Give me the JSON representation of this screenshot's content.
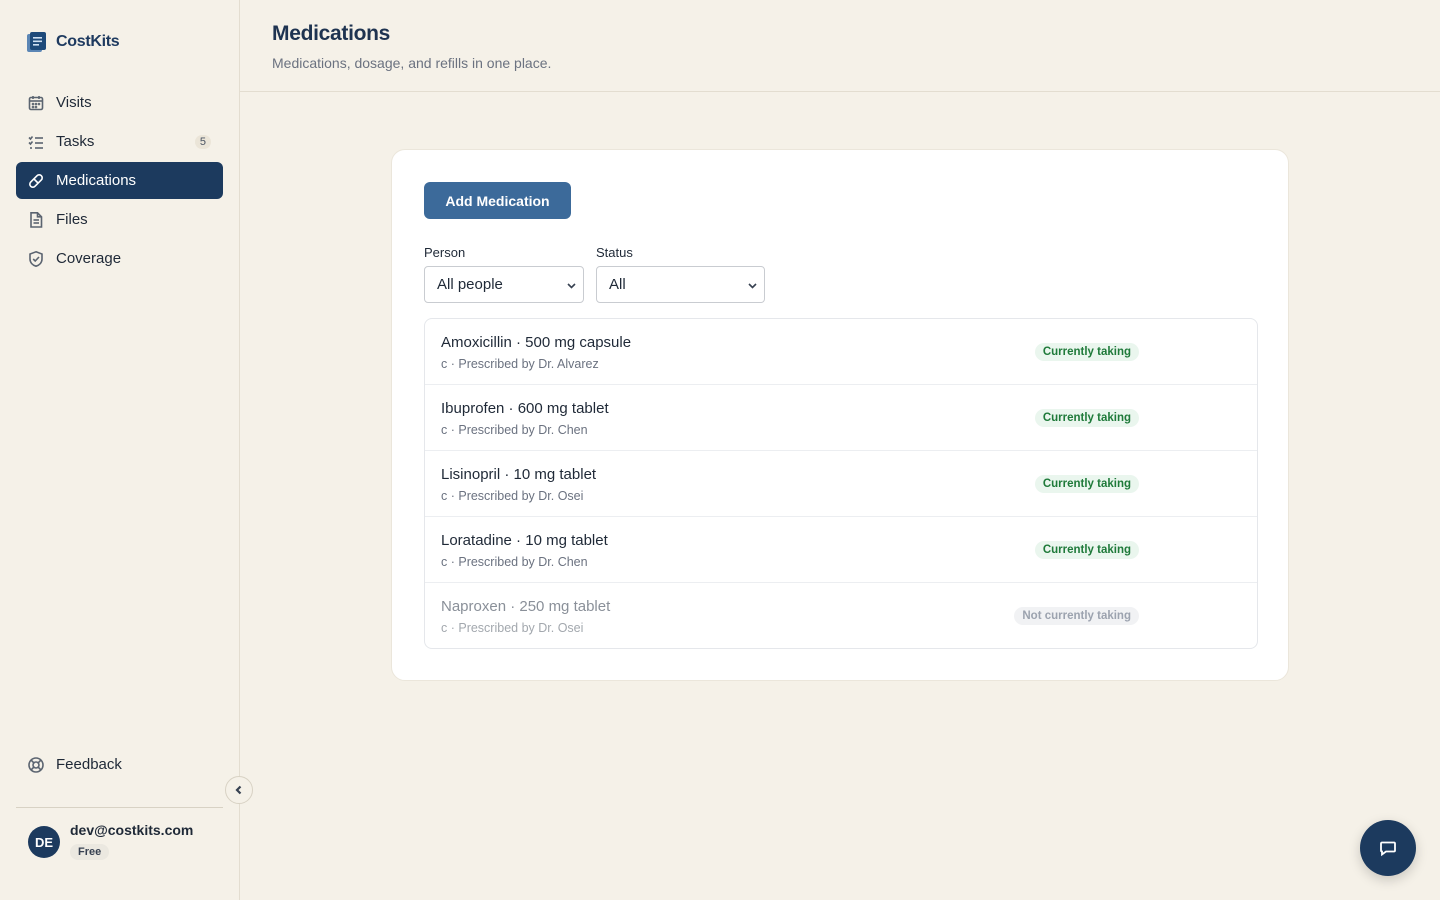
{
  "brand": {
    "name": "CostKits"
  },
  "sidebar": {
    "items": [
      {
        "label": "Visits",
        "icon": "calendar-icon"
      },
      {
        "label": "Tasks",
        "icon": "checklist-icon",
        "count": "5"
      },
      {
        "label": "Medications",
        "icon": "pill-icon",
        "active": true
      },
      {
        "label": "Files",
        "icon": "file-icon"
      },
      {
        "label": "Coverage",
        "icon": "shield-icon"
      }
    ],
    "feedback_label": "Feedback",
    "user": {
      "initials": "DE",
      "email": "dev@costkits.com",
      "plan": "Free"
    }
  },
  "header": {
    "title": "Medications",
    "subtitle": "Medications, dosage, and refills in one place."
  },
  "main": {
    "add_button": "Add Medication",
    "filters": {
      "person": {
        "label": "Person",
        "value": "All people"
      },
      "status": {
        "label": "Status",
        "value": "All"
      }
    },
    "medications": [
      {
        "title": "Amoxicillin · 500 mg capsule",
        "sub": "c · Prescribed by Dr. Alvarez",
        "status": "Currently taking",
        "active": true
      },
      {
        "title": "Ibuprofen · 600 mg tablet",
        "sub": "c · Prescribed by Dr. Chen",
        "status": "Currently taking",
        "active": true
      },
      {
        "title": "Lisinopril · 10 mg tablet",
        "sub": "c · Prescribed by Dr. Osei",
        "status": "Currently taking",
        "active": true
      },
      {
        "title": "Loratadine · 10 mg tablet",
        "sub": "c · Prescribed by Dr. Chen",
        "status": "Currently taking",
        "active": true
      },
      {
        "title": "Naproxen · 250 mg tablet",
        "sub": "c · Prescribed by Dr. Osei",
        "status": "Not currently taking",
        "active": false
      }
    ]
  },
  "colors": {
    "accent": "#1c3a5e",
    "button": "#3c6a9a",
    "background": "#f5f1e8",
    "status_active": "#1f7a3a"
  }
}
